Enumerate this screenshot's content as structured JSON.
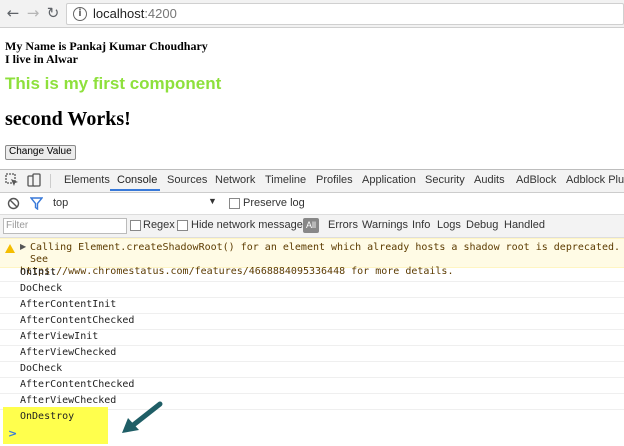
{
  "browser": {
    "url_host": "localhost",
    "url_port": ":4200"
  },
  "page": {
    "line1": "My Name is Pankaj Kumar Choudhary",
    "line2": "I live in Alwar",
    "heading_green": "This is my first component",
    "heading_second": "second Works!",
    "button_label": "Change Value"
  },
  "devtools": {
    "tabs": [
      "Elements",
      "Console",
      "Sources",
      "Network",
      "Timeline",
      "Profiles",
      "Application",
      "Security",
      "Audits",
      "AdBlock",
      "Adblock Plus"
    ],
    "active_tab": "Console",
    "context": "top",
    "preserve_log": "Preserve log",
    "filter_placeholder": "Filter",
    "regex": "Regex",
    "hide_network": "Hide network messages",
    "all": "All",
    "levels": [
      "Errors",
      "Warnings",
      "Info",
      "Logs",
      "Debug",
      "Handled"
    ],
    "warning_line1": "Calling Element.createShadowRoot() for an element which already hosts a shadow root is deprecated. See",
    "warning_line2": "https://www.chromestatus.com/features/4668884095336448 for more details.",
    "logs": [
      "OnInit",
      "DoCheck",
      "AfterContentInit",
      "AfterContentChecked",
      "AfterViewInit",
      "AfterViewChecked",
      "DoCheck",
      "AfterContentChecked",
      "AfterViewChecked",
      "OnDestroy"
    ],
    "prompt": ">"
  },
  "colors": {
    "green_heading": "#8ee03c",
    "highlight": "#ffff4d",
    "arrow": "#1f5e66",
    "warning_bg": "#fffbe5"
  }
}
